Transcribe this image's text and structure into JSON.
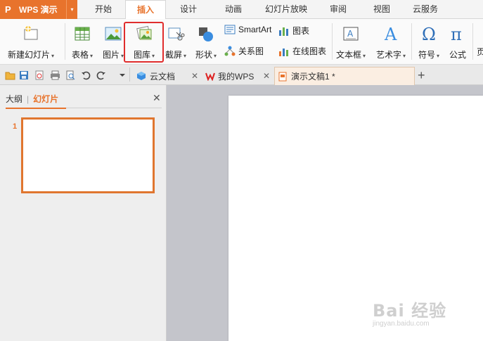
{
  "app": {
    "logo": "P",
    "name": "WPS 演示",
    "dropdown": "▾"
  },
  "menu_tabs": [
    {
      "label": "开始",
      "active": false
    },
    {
      "label": "插入",
      "active": true
    },
    {
      "label": "设计",
      "active": false
    },
    {
      "label": "动画",
      "active": false
    },
    {
      "label": "幻灯片放映",
      "active": false
    },
    {
      "label": "审阅",
      "active": false
    },
    {
      "label": "视图",
      "active": false
    },
    {
      "label": "云服务",
      "active": false
    }
  ],
  "ribbon": {
    "new_slide": "新建幻灯片",
    "table": "表格",
    "picture": "图片",
    "gallery": "图库",
    "screenshot": "截屏",
    "shape": "形状",
    "smartart": "SmartArt",
    "chart": "图表",
    "relation": "关系图",
    "online_chart": "在线图表",
    "textbox": "文本框",
    "wordart": "艺术字",
    "symbol": "符号",
    "formula": "公式",
    "cut_off": "页"
  },
  "doc_tabs": [
    {
      "label": "云文档",
      "icon": "cloud-cube-icon"
    },
    {
      "label": "我的WPS",
      "icon": "wps-logo-icon"
    },
    {
      "label": "演示文稿1 *",
      "icon": "presentation-icon"
    }
  ],
  "panel": {
    "tab_outline": "大纲",
    "tab_slides": "幻灯片",
    "divider": "|",
    "slide_number": "1"
  },
  "watermark": {
    "text": "Bai 经验",
    "url": "jingyan.baidu.com"
  },
  "colors": {
    "accent": "#e8732c",
    "highlight_box": "#e02d2d",
    "canvas_bg": "#c4c5cb"
  }
}
